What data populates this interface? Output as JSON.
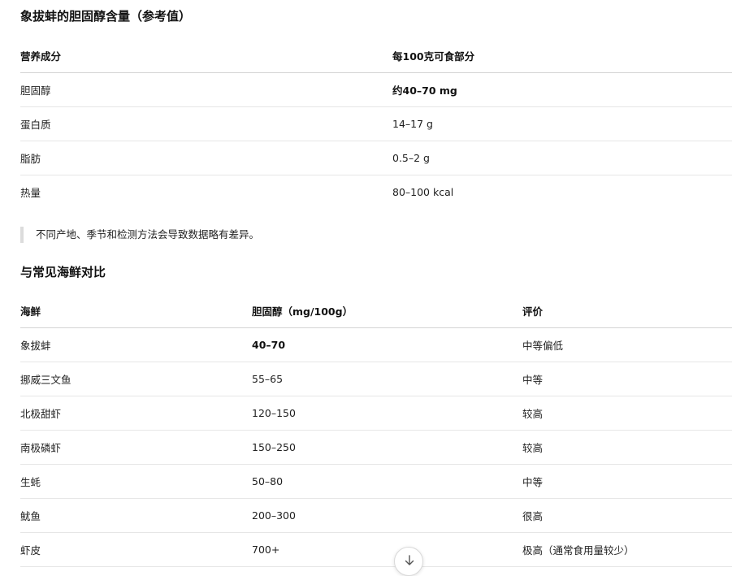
{
  "section1": {
    "title": "象拔蚌的胆固醇含量（参考值）",
    "headers": [
      "营养成分",
      "每100克可食部分"
    ],
    "rows": [
      {
        "name": "胆固醇",
        "value": "约40–70 mg",
        "emphasis": true
      },
      {
        "name": "蛋白质",
        "value": "14–17 g",
        "emphasis": false
      },
      {
        "name": "脂肪",
        "value": "0.5–2 g",
        "emphasis": false
      },
      {
        "name": "热量",
        "value": "80–100 kcal",
        "emphasis": false
      }
    ],
    "note": "不同产地、季节和检测方法会导致数据略有差异。"
  },
  "section2": {
    "title": "与常见海鲜对比",
    "headers": [
      "海鲜",
      "胆固醇（mg/100g）",
      "评价"
    ],
    "rows": [
      {
        "name": "象拔蚌",
        "value": "40–70",
        "rating": "中等偏低",
        "emphasis": true
      },
      {
        "name": "挪威三文鱼",
        "value": "55–65",
        "rating": "中等",
        "emphasis": false
      },
      {
        "name": "北极甜虾",
        "value": "120–150",
        "rating": "较高",
        "emphasis": false
      },
      {
        "name": "南极磷虾",
        "value": "150–250",
        "rating": "较高",
        "emphasis": false
      },
      {
        "name": "生蚝",
        "value": "50–80",
        "rating": "中等",
        "emphasis": false
      },
      {
        "name": "鱿鱼",
        "value": "200–300",
        "rating": "很高",
        "emphasis": false
      },
      {
        "name": "虾皮",
        "value": "700+",
        "rating": "极高（通常食用量较少）",
        "emphasis": false
      }
    ]
  },
  "scroll_button": {
    "icon": "arrow-down-icon"
  }
}
